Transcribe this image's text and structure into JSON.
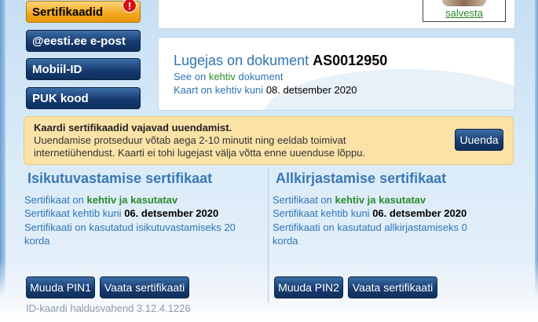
{
  "nav": {
    "items": [
      {
        "label": "Sertifikaadid",
        "active": true,
        "badge": "!"
      },
      {
        "label": "@eesti.ee e-post",
        "active": false
      },
      {
        "label": "Mobiil-ID",
        "active": false
      },
      {
        "label": "PUK kood",
        "active": false
      }
    ]
  },
  "header": {
    "photo_link": "salvesta"
  },
  "document": {
    "title_prefix": "Lugejas on dokument",
    "doc_number": "AS0012950",
    "status_prefix": "See on",
    "status_word": "kehtiv",
    "status_suffix": "dokument",
    "valid_prefix": "Kaart on kehtiv kuni",
    "valid_date": "08. detsember 2020"
  },
  "warning": {
    "title": "Kaardi sertifikaadid vajavad uuendamist.",
    "text": "Uuendamise protseduur võtab aega 2-10 minutit ning eeldab toimivat internetiühendust. Kaarti ei tohi lugejast välja võtta enne uuenduse lõppu.",
    "button": "Uuenda"
  },
  "auth_cert": {
    "title": "Isikutuvastamise sertifikaat",
    "status_prefix": "Sertifikaat on",
    "status": "kehtiv ja kasutatav",
    "expiry_prefix": "Sertifikaat kehtib kuni",
    "expiry_date": "06. detsember 2020",
    "usage_line1": "Sertifikaati on kasutatud isikutuvastamiseks 20",
    "usage_line2": "korda",
    "pin_button": "Muuda PIN1",
    "view_button": "Vaata sertifikaati"
  },
  "sign_cert": {
    "title": "Allkirjastamise sertifikaat",
    "status_prefix": "Sertifikaat on",
    "status": "kehtiv ja kasutatav",
    "expiry_prefix": "Sertifikaat kehtib kuni",
    "expiry_date": "06. detsember 2020",
    "usage_line1": "Sertifikaati on kasutatud allkirjastamiseks 0",
    "usage_line2": "korda",
    "pin_button": "Muuda PIN2",
    "view_button": "Vaata sertifikaati"
  },
  "footer": {
    "version": "ID-kaardi haldusvahend 3.12.4.1226"
  },
  "colors": {
    "accent_blue": "#2f75b5",
    "valid_green": "#2b8a2b",
    "nav_active": "#f3a81d",
    "nav_dark": "#173c70",
    "warning_bg": "#fbe2a7"
  }
}
